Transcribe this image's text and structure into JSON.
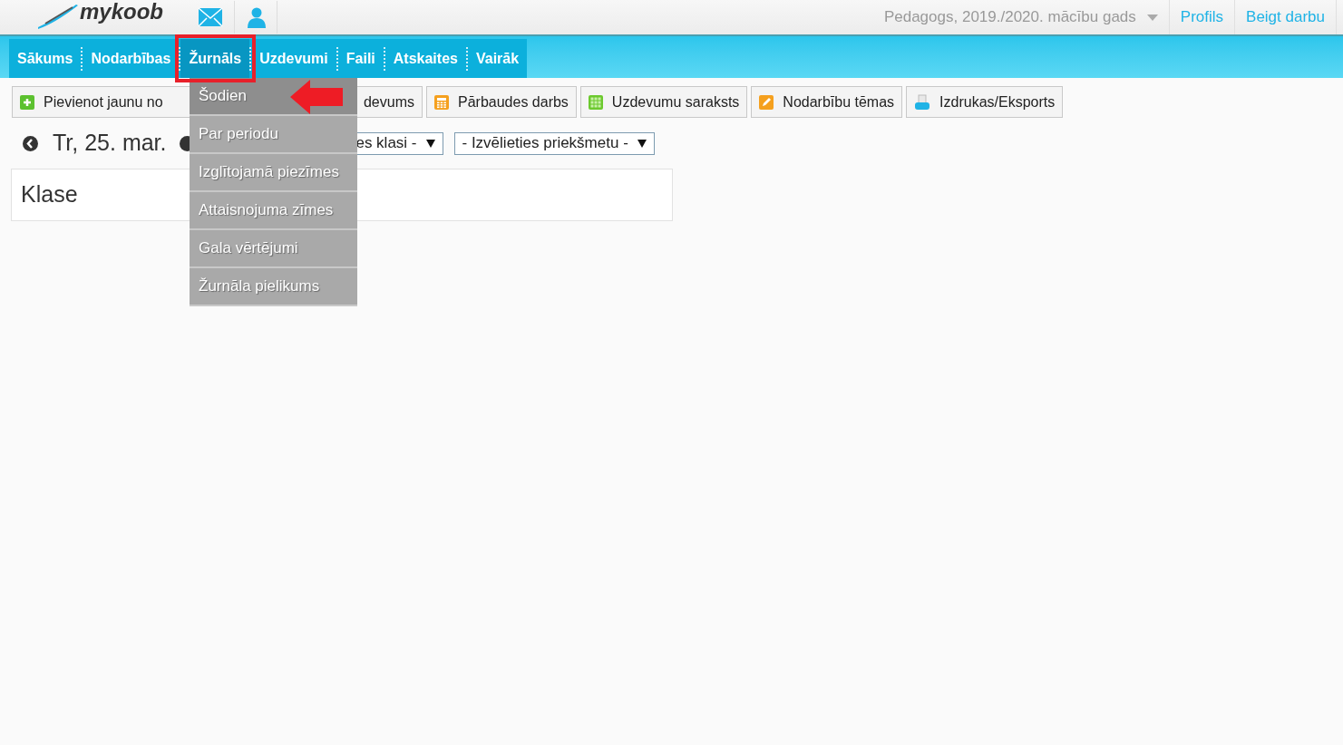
{
  "header": {
    "logo": "mykoob",
    "role_selector": "Pedagogs, 2019./2020. mācību gads",
    "links": [
      "Profils",
      "Beigt darbu"
    ]
  },
  "nav": {
    "tabs": [
      {
        "label": "Sākums",
        "selected": false
      },
      {
        "label": "Nodarbības",
        "selected": false
      },
      {
        "label": "Žurnāls",
        "selected": true
      },
      {
        "label": "Uzdevumi",
        "selected": false
      },
      {
        "label": "Faili",
        "selected": false
      },
      {
        "label": "Atskaites",
        "selected": false
      },
      {
        "label": "Vairāk",
        "selected": false
      }
    ]
  },
  "dropdown": {
    "items": [
      {
        "label": "Šodien",
        "selected": true
      },
      {
        "label": "Par periodu",
        "selected": false
      },
      {
        "label": "Izglītojamā piezīmes",
        "selected": false
      },
      {
        "label": "Attaisnojuma zīmes",
        "selected": false
      },
      {
        "label": "Gala vērtējumi",
        "selected": false
      },
      {
        "label": "Žurnāla pielikums",
        "selected": false
      }
    ]
  },
  "toolbar": {
    "buttons": [
      {
        "label": "Pievienot jaunu no",
        "kind": "plus"
      },
      {
        "label": "devums",
        "kind": "none"
      },
      {
        "label": "Pārbaudes darbs",
        "kind": "calculator"
      },
      {
        "label": "Uzdevumu saraksts",
        "kind": "grid"
      },
      {
        "label": "Nodarbību tēmas",
        "kind": "pencil"
      },
      {
        "label": "Izdrukas/Eksports",
        "kind": "printer"
      }
    ]
  },
  "date_bar": {
    "date": "Tr, 25. mar.",
    "selects": [
      "es klasi -",
      "- Izvēlieties priekšmetu -"
    ]
  },
  "panel": {
    "title": "Klase"
  }
}
